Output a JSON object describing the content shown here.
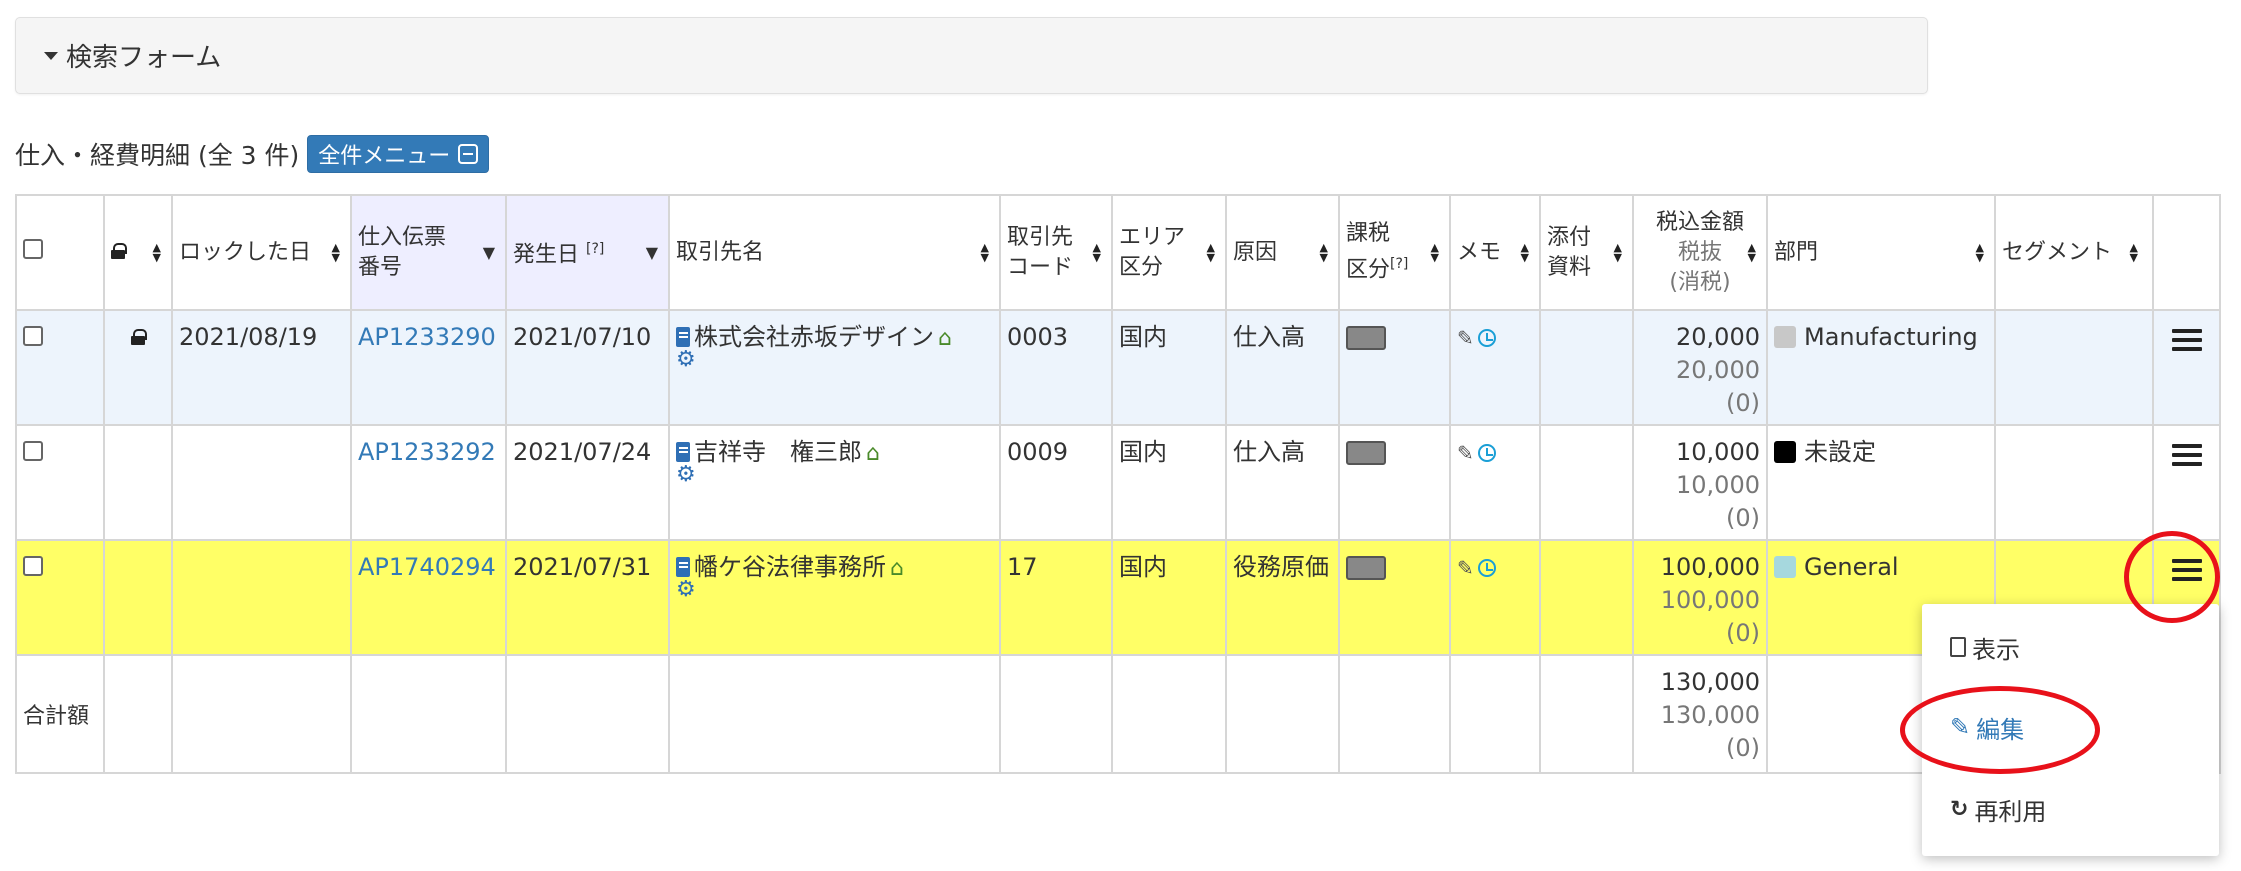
{
  "search_form": {
    "label": "検索フォーム"
  },
  "list": {
    "title": "仕入・経費明細 (全 3 件)",
    "menu_button": "全件メニュー"
  },
  "columns": {
    "locked_date": "ロックした日",
    "slip_no": "仕入伝票\n番号",
    "date": "発生日",
    "date_help": "[?]",
    "partner": "取引先名",
    "partner_code": "取引先\nコード",
    "area": "エリア\n区分",
    "cause": "原因",
    "tax": "課税\n区分",
    "tax_help": "[?]",
    "memo": "メモ",
    "attach": "添付\n資料",
    "amount_main": "税込金額",
    "amount_sub1": "税抜",
    "amount_sub2": "(消税)",
    "dept": "部門",
    "segment": "セグメント"
  },
  "rows": [
    {
      "locked_date": "2021/08/19",
      "slip_no": "AP1233290",
      "date": "2021/07/10",
      "partner": "株式会社赤坂デザイン",
      "partner_code": "0003",
      "area": "国内",
      "cause": "仕入高",
      "amount": "20,000",
      "amount_excl": "20,000",
      "tax_amount": "(0)",
      "dept": "Manufacturing",
      "dept_color": "#c8c8c8"
    },
    {
      "locked_date": "",
      "slip_no": "AP1233292",
      "date": "2021/07/24",
      "partner": "吉祥寺　権三郎",
      "partner_code": "0009",
      "area": "国内",
      "cause": "仕入高",
      "amount": "10,000",
      "amount_excl": "10,000",
      "tax_amount": "(0)",
      "dept": "未設定",
      "dept_color": "#000000"
    },
    {
      "locked_date": "",
      "slip_no": "AP1740294",
      "date": "2021/07/31",
      "partner": "幡ケ谷法律事務所",
      "partner_code": "17",
      "area": "国内",
      "cause": "役務原価",
      "amount": "100,000",
      "amount_excl": "100,000",
      "tax_amount": "(0)",
      "dept": "General",
      "dept_color": "#a6d8de"
    }
  ],
  "total": {
    "label": "合計額",
    "amount": "130,000",
    "amount_excl": "130,000",
    "tax_amount": "(0)"
  },
  "row_menu": {
    "view": "表示",
    "edit": "編集",
    "reuse": "再利用"
  },
  "colors": {
    "link": "#337ab7",
    "highlight_row": "#ffff66",
    "locked_row": "#edf4fc",
    "annotation": "#e8111a"
  }
}
